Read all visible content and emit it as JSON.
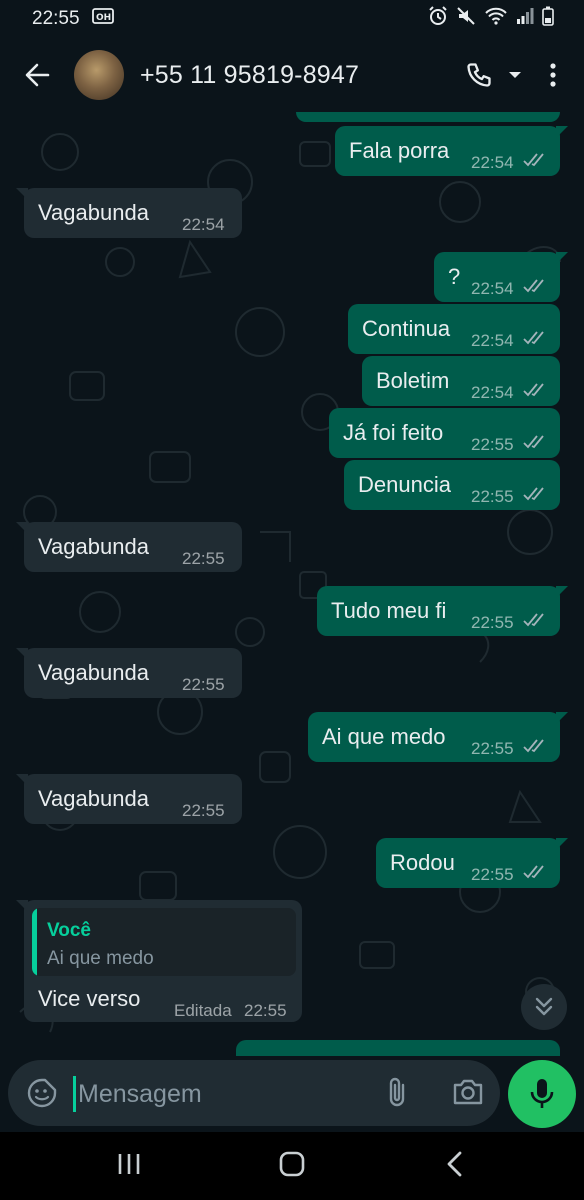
{
  "status_bar": {
    "time": "22:55"
  },
  "header": {
    "contact": "+55 11 95819-8947"
  },
  "messages": [
    {
      "dir": "out",
      "text": "Fala porra",
      "time": "22:54"
    },
    {
      "dir": "in",
      "text": "Vagabunda",
      "time": "22:54"
    },
    {
      "dir": "out",
      "text": "?",
      "time": "22:54"
    },
    {
      "dir": "out",
      "text": "Continua",
      "time": "22:54"
    },
    {
      "dir": "out",
      "text": "Boletim",
      "time": "22:54"
    },
    {
      "dir": "out",
      "text": "Já foi feito",
      "time": "22:55"
    },
    {
      "dir": "out",
      "text": "Denuncia",
      "time": "22:55"
    },
    {
      "dir": "in",
      "text": "Vagabunda",
      "time": "22:55"
    },
    {
      "dir": "out",
      "text": "Tudo meu fi",
      "time": "22:55"
    },
    {
      "dir": "in",
      "text": "Vagabunda",
      "time": "22:55"
    },
    {
      "dir": "out",
      "text": "Ai que medo",
      "time": "22:55"
    },
    {
      "dir": "in",
      "text": "Vagabunda",
      "time": "22:55"
    },
    {
      "dir": "out",
      "text": "Rodou",
      "time": "22:55"
    },
    {
      "dir": "in",
      "text": "Vice verso",
      "time": "22:55",
      "edited_label": "Editada",
      "reply_to": {
        "name": "Você",
        "text": "Ai que medo"
      }
    }
  ],
  "composer": {
    "placeholder": "Mensagem"
  },
  "colors": {
    "outgoing": "#005c4b",
    "incoming": "#202c33",
    "accent": "#21c063",
    "background": "#0b141a"
  }
}
